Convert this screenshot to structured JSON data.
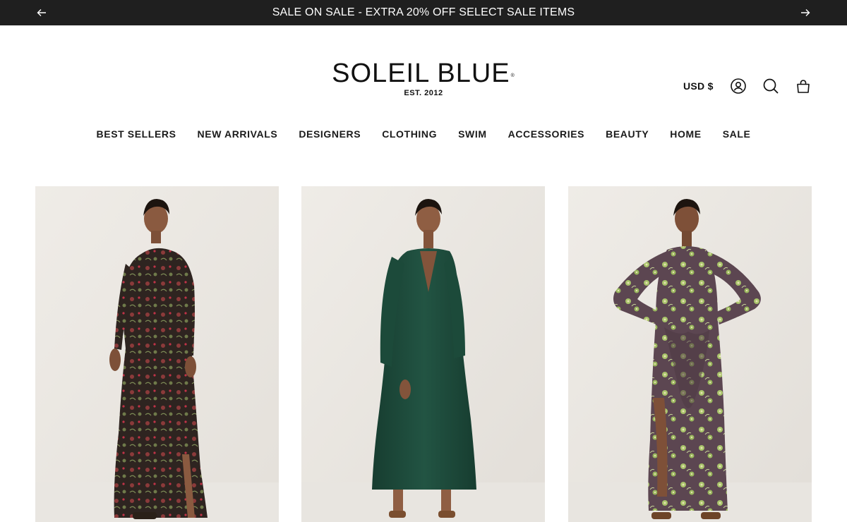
{
  "announcement": {
    "message": "SALE ON SALE - EXTRA 20% OFF SELECT SALE ITEMS",
    "prev_icon": "arrow-left-icon",
    "next_icon": "arrow-right-icon"
  },
  "logo": {
    "brand": "SOLEIL BLUE",
    "registered": "®",
    "established": "EST. 2012"
  },
  "header": {
    "currency": "USD $",
    "icons": [
      "account-icon",
      "search-icon",
      "cart-icon"
    ]
  },
  "nav": {
    "items": [
      "BEST SELLERS",
      "NEW ARRIVALS",
      "DESIGNERS",
      "CLOTHING",
      "SWIM",
      "ACCESSORIES",
      "BEAUTY",
      "HOME",
      "SALE"
    ]
  },
  "products": [
    {
      "image": "floral-print-long-sleeve-maxi-dress",
      "colors": {
        "dress": "#3a2a24",
        "accent": "#b22234"
      }
    },
    {
      "image": "green-v-neck-midi-dress",
      "colors": {
        "dress": "#1f4a3a"
      }
    },
    {
      "image": "purple-floral-wrap-maxi-dress",
      "colors": {
        "dress": "#5c4651",
        "accent": "#a8c46a"
      }
    }
  ],
  "colors": {
    "announcement_bg": "#1f1f1f",
    "text": "#111111",
    "image_bg": "#ece9e4"
  }
}
